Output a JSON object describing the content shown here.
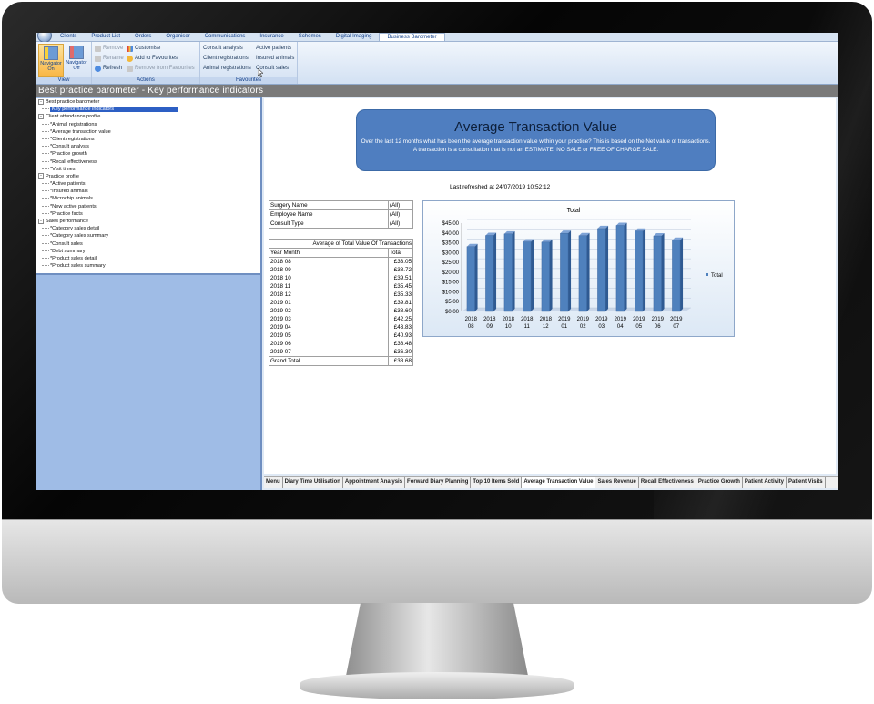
{
  "app": {
    "menu": [
      "Clients",
      "Product List",
      "Orders",
      "Organiser",
      "Communications",
      "Insurance",
      "Schemes",
      "Digital Imaging",
      "Business Barometer"
    ],
    "active_menu": "Business Barometer"
  },
  "ribbon": {
    "view": {
      "label": "View",
      "nav_on": "Navigator On",
      "nav_off": "Navigator Off"
    },
    "actions": {
      "label": "Actions",
      "remove": "Remove",
      "rename": "Rename",
      "refresh": "Refresh",
      "customise": "Customise",
      "add_fav": "Add to Favourites",
      "remove_fav": "Remove from Favourites"
    },
    "favourites": {
      "label": "Favourites",
      "col1": [
        "Consult analysis",
        "Client registrations",
        "Animal registrations"
      ],
      "col2": [
        "Active patients",
        "Insured animals",
        "Consult sales"
      ]
    }
  },
  "page_title": "Best practice barometer - Key performance indicators",
  "tree": [
    {
      "kind": "top",
      "label": "Best practice barometer"
    },
    {
      "kind": "leaf",
      "label": "Key performance indicators",
      "selected": true
    },
    {
      "kind": "top",
      "label": "Client attendance profile"
    },
    {
      "kind": "leaf",
      "label": "*Animal registrations"
    },
    {
      "kind": "leaf",
      "label": "*Average transaction value"
    },
    {
      "kind": "leaf",
      "label": "*Client registrations"
    },
    {
      "kind": "leaf",
      "label": "*Consult analysis"
    },
    {
      "kind": "leaf",
      "label": "*Practice growth"
    },
    {
      "kind": "leaf",
      "label": "*Recall effectiveness"
    },
    {
      "kind": "leaf",
      "label": "*Visit times"
    },
    {
      "kind": "top",
      "label": "Practice profile"
    },
    {
      "kind": "leaf",
      "label": "*Active patients"
    },
    {
      "kind": "leaf",
      "label": "*Insured animals"
    },
    {
      "kind": "leaf",
      "label": "*Microchip animals"
    },
    {
      "kind": "leaf",
      "label": "*New active patients"
    },
    {
      "kind": "leaf",
      "label": "*Practice facts"
    },
    {
      "kind": "top",
      "label": "Sales performance"
    },
    {
      "kind": "leaf",
      "label": "*Category sales detail"
    },
    {
      "kind": "leaf",
      "label": "*Category sales summary"
    },
    {
      "kind": "leaf",
      "label": "*Consult sales"
    },
    {
      "kind": "leaf",
      "label": "*Debt summary"
    },
    {
      "kind": "leaf",
      "label": "*Product sales detail"
    },
    {
      "kind": "leaf",
      "label": "*Product sales summary"
    }
  ],
  "report": {
    "title": "Average Transaction Value",
    "description": "Over the last 12 months what has been the average transaction value within your practice?  This is based on the Net value of transactions. A transaction is a consultation that is not an ESTIMATE, NO SALE or FREE OF CHARGE SALE.",
    "refreshed": "Last refreshed at 24/07/2019 10:52:12",
    "filters": [
      {
        "name": "Surgery Name",
        "value": "(All)"
      },
      {
        "name": "Employee Name",
        "value": "(All)"
      },
      {
        "name": "Consult Type",
        "value": "(All)"
      }
    ],
    "pivot_title": "Average of Total Value Of Transactions",
    "pivot_col1": "Year Month",
    "pivot_col2": "Total",
    "rows": [
      {
        "month": "2018 08",
        "total": "£33.05"
      },
      {
        "month": "2018 09",
        "total": "£38.72"
      },
      {
        "month": "2018 10",
        "total": "£39.51"
      },
      {
        "month": "2018 11",
        "total": "£35.45"
      },
      {
        "month": "2018 12",
        "total": "£35.33"
      },
      {
        "month": "2019 01",
        "total": "£39.81"
      },
      {
        "month": "2019 02",
        "total": "£38.60"
      },
      {
        "month": "2019 03",
        "total": "£42.25"
      },
      {
        "month": "2019 04",
        "total": "£43.83"
      },
      {
        "month": "2019 05",
        "total": "£40.93"
      },
      {
        "month": "2019 06",
        "total": "£38.48"
      },
      {
        "month": "2019 07",
        "total": "£36.30"
      }
    ],
    "grand_total_label": "Grand Total",
    "grand_total": "£38.68"
  },
  "tabs": [
    "Menu",
    "Diary Time Utilisation",
    "Appointment Analysis",
    "Forward Diary Planning",
    "Top 10 Items Sold",
    "Average Transaction Value",
    "Sales Revenue",
    "Recall Effectiveness",
    "Practice Growth",
    "Patient Activity",
    "Patient Visits"
  ],
  "active_tab": "Average Transaction Value",
  "chart_data": {
    "type": "bar",
    "title": "Total",
    "categories": [
      "2018 08",
      "2018 09",
      "2018 10",
      "2018 11",
      "2018 12",
      "2019 01",
      "2019 02",
      "2019 03",
      "2019 04",
      "2019 05",
      "2019 06",
      "2019 07"
    ],
    "series": [
      {
        "name": "Total",
        "values": [
          33.05,
          38.72,
          39.51,
          35.45,
          35.33,
          39.81,
          38.6,
          42.25,
          43.83,
          40.93,
          38.48,
          36.3
        ]
      }
    ],
    "yticks": [
      "$0.00",
      "$5.00",
      "$10.00",
      "$15.00",
      "$20.00",
      "$25.00",
      "$30.00",
      "$35.00",
      "$40.00",
      "$45.00"
    ],
    "ylim": [
      0,
      45
    ],
    "legend": "right",
    "bar_color": "#4f81bd"
  }
}
